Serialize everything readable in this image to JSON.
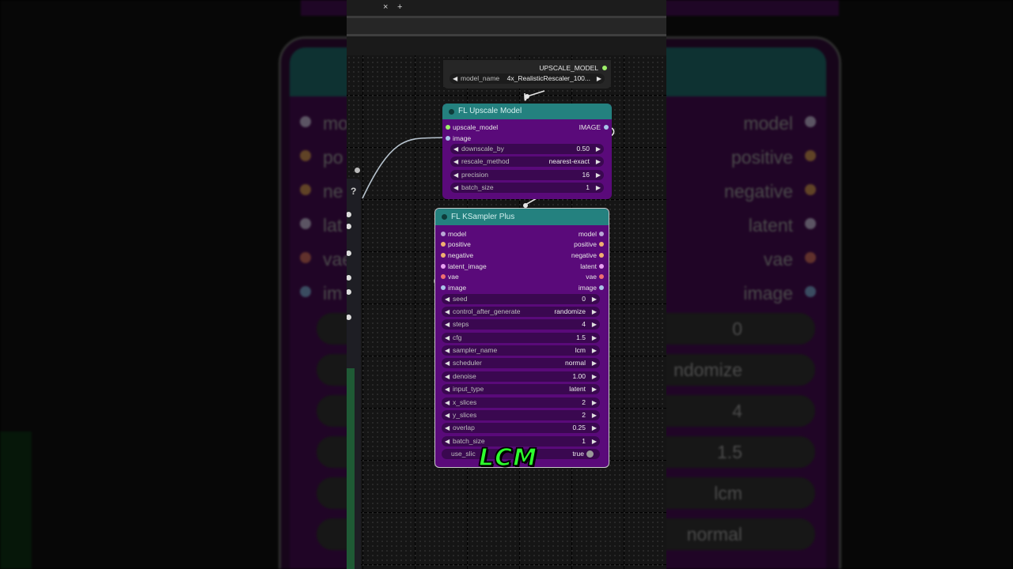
{
  "tabbar": {
    "close_symbol": "×",
    "new_tab_symbol": "+"
  },
  "left_panel": {
    "help_symbol": "?"
  },
  "upscale_loader": {
    "output_label": "UPSCALE_MODEL",
    "model_name_label": "model_name",
    "model_name_value": "4x_RealisticRescaler_100...",
    "arrow_left": "◀",
    "arrow_right": "▶"
  },
  "fl_upscale_model": {
    "title": "FL Upscale Model",
    "inputs": [
      "upscale_model",
      "image"
    ],
    "output": "IMAGE",
    "widgets": [
      {
        "name": "downscale_by",
        "value": "0.50"
      },
      {
        "name": "rescale_method",
        "value": "nearest-exact"
      },
      {
        "name": "precision",
        "value": "16"
      },
      {
        "name": "batch_size",
        "value": "1"
      }
    ]
  },
  "fl_ksampler_plus": {
    "title": "FL KSampler Plus",
    "inputs": [
      "model",
      "positive",
      "negative",
      "latent_image",
      "vae",
      "image"
    ],
    "outputs": [
      "model",
      "positive",
      "negative",
      "latent",
      "vae",
      "image"
    ],
    "widgets": [
      {
        "name": "seed",
        "value": "0"
      },
      {
        "name": "control_after_generate",
        "value": "randomize"
      },
      {
        "name": "steps",
        "value": "4"
      },
      {
        "name": "cfg",
        "value": "1.5"
      },
      {
        "name": "sampler_name",
        "value": "lcm"
      },
      {
        "name": "scheduler",
        "value": "normal"
      },
      {
        "name": "denoise",
        "value": "1.00"
      },
      {
        "name": "input_type",
        "value": "latent"
      },
      {
        "name": "x_slices",
        "value": "2"
      },
      {
        "name": "y_slices",
        "value": "2"
      },
      {
        "name": "overlap",
        "value": "0.25"
      },
      {
        "name": "batch_size",
        "value": "1"
      }
    ],
    "toggle": {
      "name": "use_slic",
      "value": "true"
    }
  },
  "caption": "LCM",
  "background_mirror": {
    "outputs": [
      "model",
      "positive",
      "negative",
      "latent",
      "vae",
      "image"
    ],
    "inputs": [
      "mod",
      "po",
      "ne",
      "lat",
      "vae",
      "im"
    ],
    "widget_values": [
      "0",
      "ndomize",
      "4",
      "1.5",
      "lcm",
      "normal"
    ]
  },
  "colors": {
    "node_body": "#5a0a7a",
    "node_header": "#24817f",
    "widget": "#3a0850",
    "caption": "#2dff2d"
  }
}
